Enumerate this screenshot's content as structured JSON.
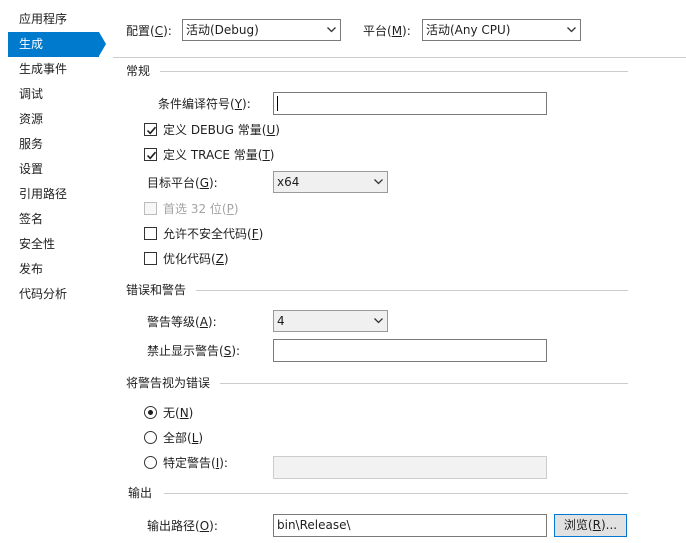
{
  "sidebar": {
    "items": [
      {
        "label": "应用程序",
        "active": false
      },
      {
        "label": "生成",
        "active": true
      },
      {
        "label": "生成事件",
        "active": false
      },
      {
        "label": "调试",
        "active": false
      },
      {
        "label": "资源",
        "active": false
      },
      {
        "label": "服务",
        "active": false
      },
      {
        "label": "设置",
        "active": false
      },
      {
        "label": "引用路径",
        "active": false
      },
      {
        "label": "签名",
        "active": false
      },
      {
        "label": "安全性",
        "active": false
      },
      {
        "label": "发布",
        "active": false
      },
      {
        "label": "代码分析",
        "active": false
      }
    ]
  },
  "top": {
    "config_label": "配置(",
    "config_key": "C",
    "config_suffix": "):",
    "config_value": "活动(Debug)",
    "platform_label": "平台(",
    "platform_key": "M",
    "platform_suffix": "):",
    "platform_value": "活动(Any CPU)"
  },
  "general": {
    "title": "常规",
    "symbols_label": "条件编译符号(",
    "symbols_key": "Y",
    "symbols_suffix": "):",
    "symbols_value": "",
    "debug_label": "定义 DEBUG 常量(",
    "debug_key": "U",
    "debug_suffix": ")",
    "debug_checked": true,
    "trace_label": "定义 TRACE 常量(",
    "trace_key": "T",
    "trace_suffix": ")",
    "trace_checked": true,
    "target_label": "目标平台(",
    "target_key": "G",
    "target_suffix": "):",
    "target_value": "x64",
    "prefer32_label": "首选 32 位(",
    "prefer32_key": "P",
    "prefer32_suffix": ")",
    "prefer32_checked": false,
    "unsafe_label": "允许不安全代码(",
    "unsafe_key": "F",
    "unsafe_suffix": ")",
    "unsafe_checked": false,
    "optimize_label": "优化代码(",
    "optimize_key": "Z",
    "optimize_suffix": ")",
    "optimize_checked": false
  },
  "errors": {
    "title": "错误和警告",
    "level_label": "警告等级(",
    "level_key": "A",
    "level_suffix": "):",
    "level_value": "4",
    "suppress_label": "禁止显示警告(",
    "suppress_key": "S",
    "suppress_suffix": "):",
    "suppress_value": ""
  },
  "treat": {
    "title": "将警告视为错误",
    "none_label": "无(",
    "none_key": "N",
    "none_suffix": ")",
    "all_label": "全部(",
    "all_key": "L",
    "all_suffix": ")",
    "specific_label": "特定警告(",
    "specific_key": "I",
    "specific_suffix": "):",
    "specific_value": "",
    "selected": "none"
  },
  "output": {
    "title": "输出",
    "path_label": "输出路径(",
    "path_key": "O",
    "path_suffix": "):",
    "path_value": "bin\\Release\\",
    "browse_label": "浏览(",
    "browse_key": "R",
    "browse_suffix": ")..."
  },
  "colors": {
    "accent": "#007acc",
    "separator": "#cccccc"
  }
}
